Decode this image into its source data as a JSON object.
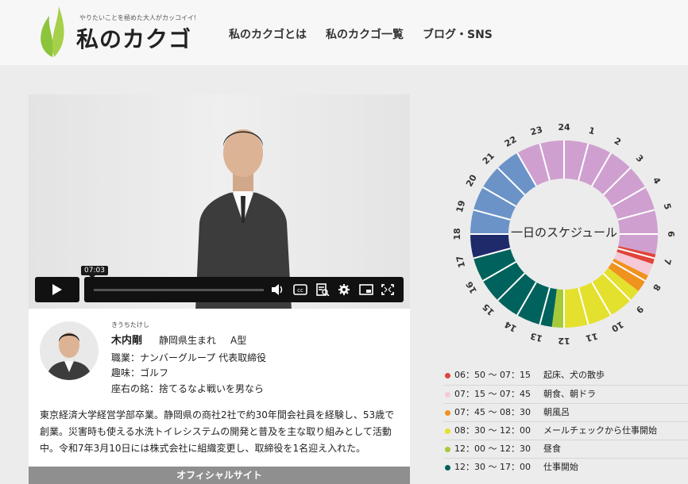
{
  "header": {
    "tagline": "やりたいことを極めた大人がカッコイイ!",
    "logo": "私のカクゴ",
    "nav": [
      "私のカクゴとは",
      "私のカクゴ一覧",
      "ブログ・SNS"
    ]
  },
  "video": {
    "current_time": "07:03",
    "progress": 0.0,
    "controls": [
      "play-icon",
      "volume-icon",
      "captions-icon",
      "transcript-icon",
      "settings-icon",
      "pip-icon",
      "fullscreen-icon"
    ]
  },
  "profile": {
    "ruby": "きうちたけし",
    "name": "木内剛",
    "origin": "静岡県生まれ",
    "blood": "A型",
    "job": "職業：ナンバーグループ 代表取締役",
    "hobby": "趣味：ゴルフ",
    "motto": "座右の銘：捨てるなよ戦いを男なら",
    "bio": "東京経済大学経営学部卒業。静岡県の商社2社で約30年間会社員を経験し、53歳で創業。災害時も使える水洗トイレシステムの開発と普及を主な取り組みとして活動中。令和7年3月10日には株式会社に組織変更し、取締役を1名迎え入れた。",
    "official_site": "オフィシャルサイト"
  },
  "clock": {
    "title": "一日のスケジュール",
    "hours": [
      "24",
      "1",
      "2",
      "3",
      "4",
      "5",
      "6",
      "7",
      "8",
      "9",
      "10",
      "11",
      "12",
      "13",
      "14",
      "15",
      "16",
      "17",
      "18",
      "19",
      "20",
      "21",
      "22",
      "23"
    ],
    "segments": [
      {
        "start": "00:00",
        "end": "06:50",
        "color": "#cfa0cf"
      },
      {
        "start": "06:50",
        "end": "07:15",
        "color": "#e0443a"
      },
      {
        "start": "07:15",
        "end": "07:45",
        "color": "#f6c9d6"
      },
      {
        "start": "07:45",
        "end": "08:30",
        "color": "#f0921e"
      },
      {
        "start": "08:30",
        "end": "12:00",
        "color": "#e4e02e"
      },
      {
        "start": "12:00",
        "end": "12:30",
        "color": "#a6c93a"
      },
      {
        "start": "12:30",
        "end": "17:00",
        "color": "#00625c"
      },
      {
        "start": "17:00",
        "end": "18:00",
        "color": "#1f2a6b"
      },
      {
        "start": "18:00",
        "end": "22:00",
        "color": "#6b93c7"
      },
      {
        "start": "22:00",
        "end": "24:00",
        "color": "#cfa0cf"
      }
    ]
  },
  "schedule": [
    {
      "time": "06：50 〜 07：15",
      "activity": "起床、犬の散歩",
      "color": "#e0443a"
    },
    {
      "time": "07：15 〜 07：45",
      "activity": "朝食、朝ドラ",
      "color": "#f6c9d6"
    },
    {
      "time": "07：45 〜 08：30",
      "activity": "朝風呂",
      "color": "#f0921e"
    },
    {
      "time": "08：30 〜 12：00",
      "activity": "メールチェックから仕事開始",
      "color": "#e4e02e"
    },
    {
      "time": "12：00 〜 12：30",
      "activity": "昼食",
      "color": "#a6c93a"
    },
    {
      "time": "12：30 〜 17：00",
      "activity": "仕事開始",
      "color": "#00625c"
    }
  ]
}
